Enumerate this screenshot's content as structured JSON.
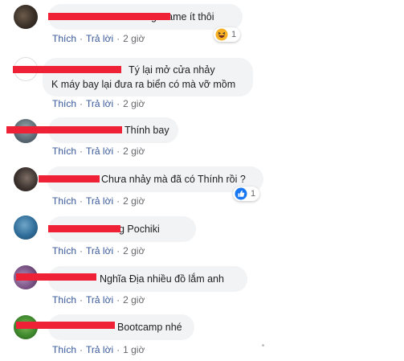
{
  "colors": {
    "bubble": "#f2f3f5",
    "redaction": "#ee2136",
    "meta": "#65676b",
    "link": "#385898"
  },
  "comments": [
    {
      "author": "",
      "lines": [
        "g Game ít thôi"
      ],
      "like": "Thích",
      "reply": "Trả lời",
      "time": "2 giờ",
      "reaction": {
        "icon": "haha-icon",
        "count": "1"
      }
    },
    {
      "author": "",
      "lines": [
        "Tý lại mở cửa nhảy",
        "K máy bay lại đưa ra biển có mà vỡ mồm"
      ],
      "like": "Thích",
      "reply": "Trả lời",
      "time": "2 giờ"
    },
    {
      "author": "",
      "lines": [
        "Thính bay"
      ],
      "like": "Thích",
      "reply": "Trả lời",
      "time": "2 giờ"
    },
    {
      "author": "",
      "lines": [
        "Chưa nhảy mà đã có Thính rồi ?"
      ],
      "like": "Thích",
      "reply": "Trả lời",
      "time": "2 giờ",
      "reaction": {
        "icon": "like-icon",
        "count": "1"
      }
    },
    {
      "author": "",
      "lines": [
        "g Pochiki"
      ],
      "like": "Thích",
      "reply": "Trả lời",
      "time": "2 giờ"
    },
    {
      "author": "",
      "lines": [
        "Nghĩa Địa nhiều đồ lắm anh"
      ],
      "like": "Thích",
      "reply": "Trả lời",
      "time": "2 giờ"
    },
    {
      "author": "",
      "lines": [
        "Bootcamp nhé"
      ],
      "like": "Thích",
      "reply": "Trả lời",
      "time": "1 giờ"
    }
  ],
  "separator": "·"
}
